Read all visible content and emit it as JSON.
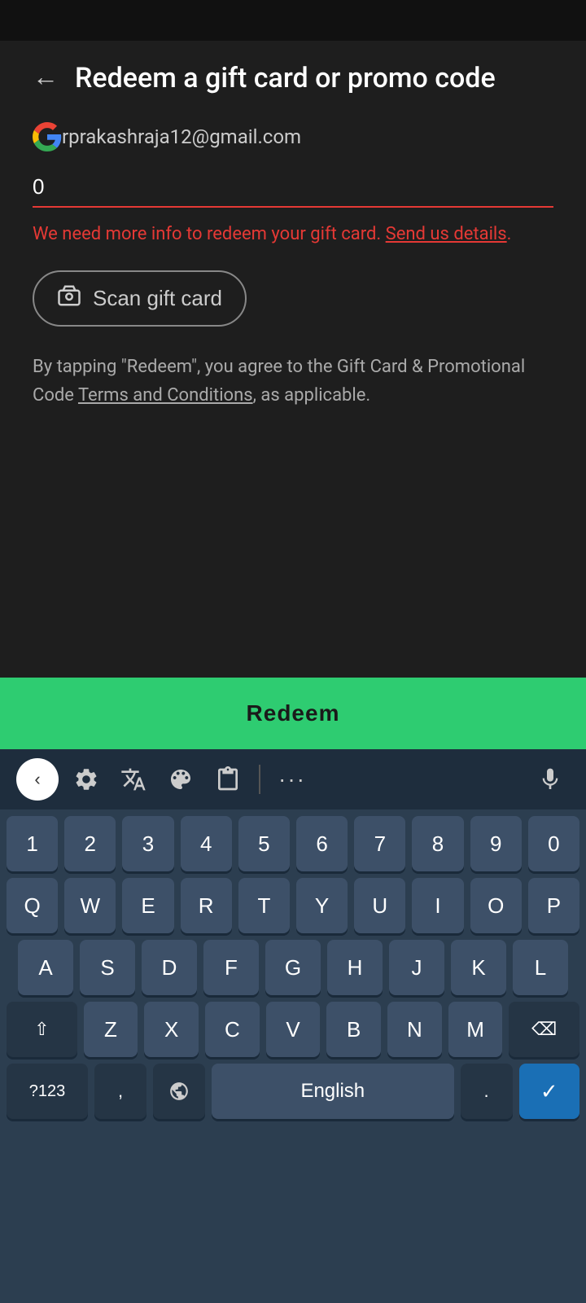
{
  "statusBar": {},
  "header": {
    "backLabel": "←",
    "title": "Redeem a gift card or promo code"
  },
  "account": {
    "email": "rprakashraja12@gmail.com"
  },
  "input": {
    "value": "0",
    "placeholder": ""
  },
  "error": {
    "message": "We need more info to redeem your gift card. ",
    "link": "Send us details",
    "suffix": "."
  },
  "scanButton": {
    "label": "Scan gift card"
  },
  "terms": {
    "prefix": "By tapping \"Redeem\", you agree to the Gift Card & Promotional Code ",
    "link": "Terms and Conditions",
    "suffix": ", as applicable."
  },
  "redeemButton": {
    "label": "Redeem"
  },
  "keyboard": {
    "numbers": [
      "1",
      "2",
      "3",
      "4",
      "5",
      "6",
      "7",
      "8",
      "9",
      "0"
    ],
    "row1": [
      "Q",
      "W",
      "E",
      "R",
      "T",
      "Y",
      "U",
      "I",
      "O",
      "P"
    ],
    "row2": [
      "A",
      "S",
      "D",
      "F",
      "G",
      "H",
      "J",
      "K",
      "L"
    ],
    "row3": [
      "Z",
      "X",
      "C",
      "V",
      "B",
      "N",
      "M"
    ],
    "bottomLeft": "?123",
    "comma": ",",
    "language": "English",
    "period": ".",
    "enter": "✓"
  },
  "navBar": {
    "menuIcon": "≡",
    "homeIcon": "⌂",
    "backIcon": "⬚"
  }
}
